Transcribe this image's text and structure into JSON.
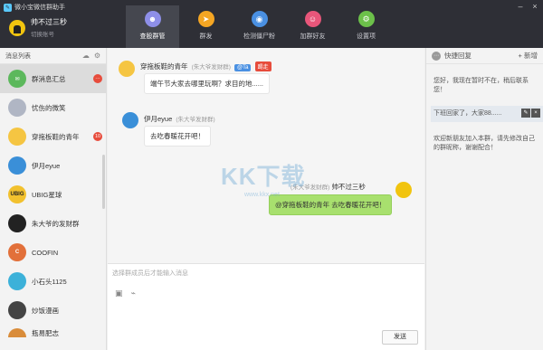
{
  "app": {
    "title": "微小宝微信群助手"
  },
  "user": {
    "name": "帅不过三秒",
    "switch_label": "切换账号"
  },
  "nav": [
    {
      "label": "查股群管",
      "icon": "person-icon",
      "color": "#8e8fe8"
    },
    {
      "label": "群发",
      "icon": "send-icon",
      "color": "#f5a623"
    },
    {
      "label": "检测僵尸粉",
      "icon": "detect-icon",
      "color": "#4a90e2"
    },
    {
      "label": "加群好友",
      "icon": "add-friend-icon",
      "color": "#e8567a"
    },
    {
      "label": "设置项",
      "icon": "gear-icon",
      "color": "#6cc04a"
    }
  ],
  "left": {
    "title": "消息列表",
    "items": [
      {
        "name": "群消息汇总",
        "color": "#5cb85c",
        "badge": "···"
      },
      {
        "name": "忧伤的微笑",
        "color": "#b0b6c4",
        "badge": ""
      },
      {
        "name": "穿拖板鞋的青年",
        "color": "#f5c542",
        "badge": "10"
      },
      {
        "name": "伊月eyue",
        "color": "#3a8fd8",
        "badge": ""
      },
      {
        "name": "UBIG星球",
        "color": "#f2c12e",
        "badge": ""
      },
      {
        "name": "朱大爷的发财群",
        "color": "#222222",
        "badge": ""
      },
      {
        "name": "COOFIN",
        "color": "#e2703a",
        "badge": ""
      },
      {
        "name": "小石头1125",
        "color": "#3cb1d9",
        "badge": ""
      },
      {
        "name": "炒饭漫画",
        "color": "#444444",
        "badge": ""
      },
      {
        "name": "瓶易肥志",
        "color": "#d98c3a",
        "badge": ""
      }
    ]
  },
  "messages": [
    {
      "sender": "穿拖板鞋的青年",
      "group": "(朱大爷发财群)",
      "tag1": "@Ta",
      "tag2": "踢走",
      "text": "端午节大家去哪里玩啊？求目的地......"
    },
    {
      "sender": "伊月eyue",
      "group": "(朱大爷发财群)",
      "text": "去吃春暖花开吧！"
    },
    {
      "sender": "帅不过三秒",
      "group": "(朱大爷发财群)",
      "text": "@穿拖板鞋的青年 去吃春暖花开吧！"
    }
  ],
  "watermark": {
    "text": "KK下载",
    "url": "www.kkx.net"
  },
  "input": {
    "placeholder": "选择群成员后才能输入消息",
    "send_label": "发送"
  },
  "quick_reply": {
    "title": "快捷回复",
    "add_label": "+ 新增",
    "items": [
      "您好，我现在暂时不在，稍后联系您！",
      "下班回家了，大家88......",
      "欢迎新朋友加入本群，请先修改自己的群昵称，谢谢配合！"
    ]
  }
}
